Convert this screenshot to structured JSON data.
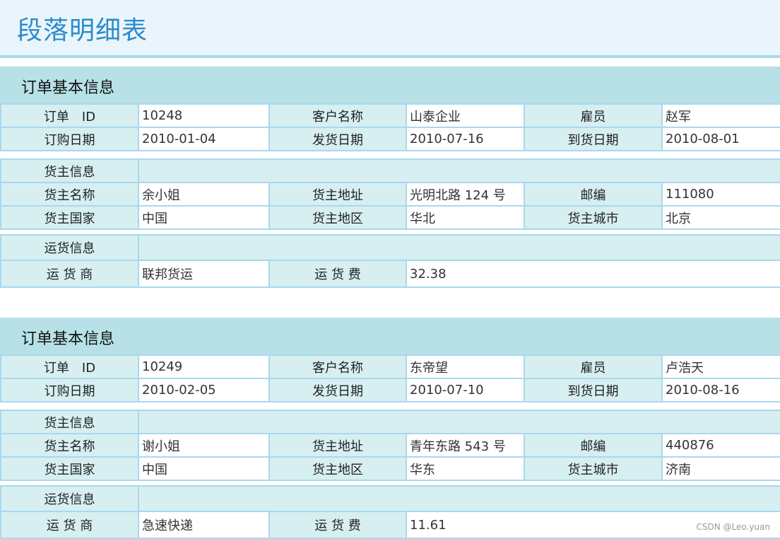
{
  "title": "段落明细表",
  "watermark": "CSDN @Leo.yuan",
  "orders": [
    {
      "section_title": "订单基本信息",
      "order_id_label": "订单　ID",
      "order_id": "10248",
      "customer_label": "客户名称",
      "customer": "山泰企业",
      "employee_label": "雇员",
      "employee": "赵军",
      "order_date_label": "订购日期",
      "order_date": "2010-01-04",
      "ship_date_label": "发货日期",
      "ship_date": "2010-07-16",
      "arrive_date_label": "到货日期",
      "arrive_date": "2010-08-01",
      "shipper_info_label": "货主信息",
      "shipper_name_label": "货主名称",
      "shipper_name": "余小姐",
      "shipper_addr_label": "货主地址",
      "shipper_addr": "光明北路 124 号",
      "zip_label": "邮编",
      "zip": "111080",
      "country_label": "货主国家",
      "country": "中国",
      "region_label": "货主地区",
      "region": "华北",
      "city_label": "货主城市",
      "city": "北京",
      "freight_info_label": "运货信息",
      "carrier_label": "运 货 商",
      "carrier": "联邦货运",
      "fee_label": "运 货 费",
      "fee": "32.38"
    },
    {
      "section_title": "订单基本信息",
      "order_id_label": "订单　ID",
      "order_id": "10249",
      "customer_label": "客户名称",
      "customer": "东帝望",
      "employee_label": "雇员",
      "employee": "卢浩天",
      "order_date_label": "订购日期",
      "order_date": "2010-02-05",
      "ship_date_label": "发货日期",
      "ship_date": "2010-07-10",
      "arrive_date_label": "到货日期",
      "arrive_date": "2010-08-16",
      "shipper_info_label": "货主信息",
      "shipper_name_label": "货主名称",
      "shipper_name": "谢小姐",
      "shipper_addr_label": "货主地址",
      "shipper_addr": "青年东路 543 号",
      "zip_label": "邮编",
      "zip": "440876",
      "country_label": "货主国家",
      "country": "中国",
      "region_label": "货主地区",
      "region": "华东",
      "city_label": "货主城市",
      "city": "济南",
      "freight_info_label": "运货信息",
      "carrier_label": "运 货 商",
      "carrier": "急速快递",
      "fee_label": "运 货 费",
      "fee": "11.61"
    }
  ]
}
